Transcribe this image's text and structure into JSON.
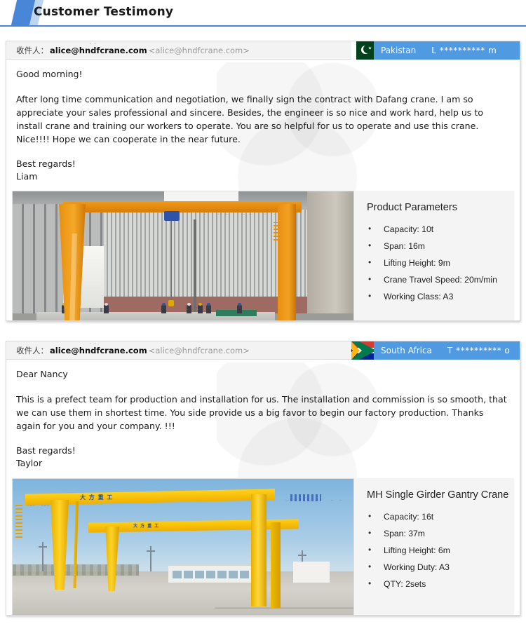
{
  "header": {
    "title": "Customer Testimony"
  },
  "testimonials": [
    {
      "mail": {
        "recipient_label": "收件人：",
        "recipient_name": "alice@hndfcrane.com",
        "recipient_address": "<alice@hndfcrane.com>",
        "ghost_text": "·        ·"
      },
      "country": {
        "flag": "pakistan-flag-icon",
        "name": "Pakistan",
        "contact_masked": "L ********** m"
      },
      "body": {
        "greeting": "Good morning!",
        "paragraph": "After long time communication and negotiation, we finally sign the contract with Dafang crane.  I am so appreciate your sales professional and sincere. Besides, the engineer is so nice and work hard, help us to install crane and training our workers to operate. You are so helpful for us to operate and use this crane. Nice!!!! Hope we can cooperate in the near future.",
        "signoff_line1": "Best regards!",
        "signoff_line2": "Liam"
      },
      "photo": {
        "alt": "indoor-single-girder-gantry-crane-photo"
      },
      "specs": {
        "title": "Product Parameters",
        "items": [
          "Capacity: 10t",
          "Span: 16m",
          "Lifting Height: 9m",
          "Crane Travel Speed: 20m/min",
          "Working Class: A3"
        ]
      }
    },
    {
      "mail": {
        "recipient_label": "收件人：",
        "recipient_name": "alice@hndfcrane.com",
        "recipient_address": "<alice@hndfcrane.com>",
        "ghost_text": "·        ·"
      },
      "country": {
        "flag": "south-africa-flag-icon",
        "name": "South Africa",
        "contact_masked": "T ********** o"
      },
      "body": {
        "greeting": "Dear Nancy",
        "paragraph": "This is a prefect team for production and installation for us. The installation and commission is so smooth, that we can use them in shortest time. You side provide us a big favor to begin our factory production. Thanks again for you and your company. !!!",
        "signoff_line1": "Bast regards!",
        "signoff_line2": "Taylor"
      },
      "photo": {
        "alt": "outdoor-mh-single-girder-gantry-crane-photo"
      },
      "specs": {
        "title": "MH Single Girder Gantry Crane",
        "items": [
          "Capacity: 16t",
          "Span: 37m",
          "Lifting Height: 6m",
          "Working Duty: A3",
          "QTY: 2sets"
        ]
      }
    }
  ],
  "colors": {
    "accent_blue": "#4a86d8",
    "chip_blue": "#4f9ae0",
    "chip_light": "#bcd6f2",
    "spec_bg": "#f4f4f4",
    "mail_head_bg": "#f3f3f3",
    "pakistan_green": "#01411c",
    "sa_green": "#007a4d",
    "crane_orange": "#f09a1a",
    "crane_yellow": "#ffd11a"
  },
  "photo_logo_text": {
    "line1": "大 方 重 工",
    "line2": "大 方 重 工"
  }
}
